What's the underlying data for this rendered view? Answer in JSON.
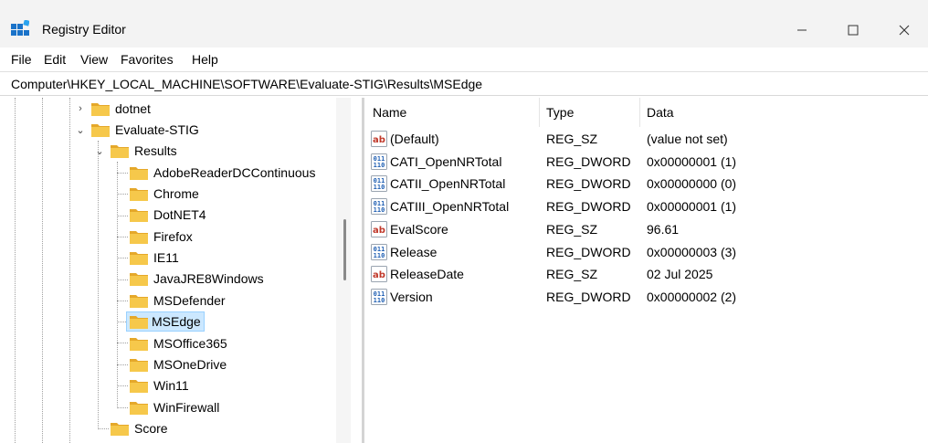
{
  "window": {
    "title": "Registry Editor",
    "controls": {
      "minimize": "minimize",
      "maximize": "maximize",
      "close": "close"
    }
  },
  "menu": [
    "File",
    "Edit",
    "View",
    "Favorites",
    "Help"
  ],
  "address": "Computer\\HKEY_LOCAL_MACHINE\\SOFTWARE\\Evaluate-STIG\\Results\\MSEdge",
  "tree": {
    "items": [
      {
        "label": "dotnet",
        "expander": "collapsed"
      },
      {
        "label": "Evaluate-STIG",
        "expander": "expanded"
      },
      {
        "label": "Results",
        "expander": "expanded"
      },
      {
        "label": "AdobeReaderDCContinuous"
      },
      {
        "label": "Chrome"
      },
      {
        "label": "DotNET4"
      },
      {
        "label": "Firefox"
      },
      {
        "label": "IE11"
      },
      {
        "label": "JavaJRE8Windows"
      },
      {
        "label": "MSDefender"
      },
      {
        "label": "MSEdge",
        "selected": true
      },
      {
        "label": "MSOffice365"
      },
      {
        "label": "MSOneDrive"
      },
      {
        "label": "Win11"
      },
      {
        "label": "WinFirewall"
      },
      {
        "label": "Score"
      }
    ]
  },
  "list": {
    "headers": {
      "name": "Name",
      "type": "Type",
      "data": "Data"
    },
    "rows": [
      {
        "icon": "string-value-icon",
        "name": "(Default)",
        "type": "REG_SZ",
        "data": "(value not set)"
      },
      {
        "icon": "dword-value-icon",
        "name": "CATI_OpenNRTotal",
        "type": "REG_DWORD",
        "data": "0x00000001 (1)"
      },
      {
        "icon": "dword-value-icon",
        "name": "CATII_OpenNRTotal",
        "type": "REG_DWORD",
        "data": "0x00000000 (0)"
      },
      {
        "icon": "dword-value-icon",
        "name": "CATIII_OpenNRTotal",
        "type": "REG_DWORD",
        "data": "0x00000001 (1)"
      },
      {
        "icon": "string-value-icon",
        "name": "EvalScore",
        "type": "REG_SZ",
        "data": "96.61"
      },
      {
        "icon": "dword-value-icon",
        "name": "Release",
        "type": "REG_DWORD",
        "data": "0x00000003 (3)"
      },
      {
        "icon": "string-value-icon",
        "name": "ReleaseDate",
        "type": "REG_SZ",
        "data": "02 Jul 2025"
      },
      {
        "icon": "dword-value-icon",
        "name": "Version",
        "type": "REG_DWORD",
        "data": "0x00000002 (2)"
      }
    ]
  },
  "colors": {
    "folder": "#f4c542",
    "selection": "#cce8ff",
    "string_icon": "#c0392b",
    "dword_icon": "#1f5fb3"
  }
}
